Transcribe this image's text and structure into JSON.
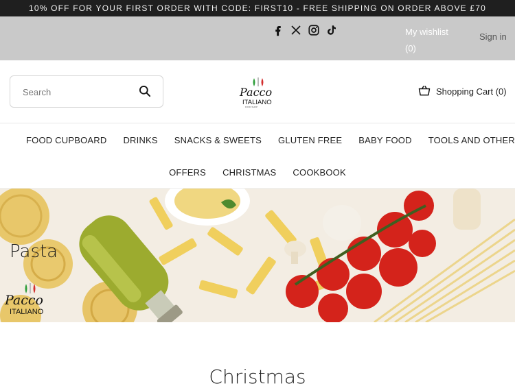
{
  "promo": {
    "text": "10% OFF FOR YOUR FIRST ORDER WITH CODE: FIRST10 - FREE SHIPPING ON ORDER ABOVE £70"
  },
  "topbar": {
    "social": [
      "facebook-icon",
      "x-icon",
      "instagram-icon",
      "tiktok-icon"
    ],
    "wishlist_label": "My wishlist",
    "wishlist_count": "(0)",
    "signin_label": "Sign in"
  },
  "header": {
    "search_placeholder": "Search",
    "logo": {
      "line1": "Pacco",
      "line2": "ITALIANO",
      "colors": [
        "#2e9e3a",
        "#ffffff",
        "#d32f2f"
      ]
    },
    "cart_label": "Shopping Cart (0)"
  },
  "nav": {
    "row1": [
      "FOOD CUPBOARD",
      "DRINKS",
      "SNACKS & SWEETS",
      "GLUTEN FREE",
      "BABY FOOD",
      "TOOLS AND OTHER"
    ],
    "row2": [
      "OFFERS",
      "CHRISTMAS",
      "COOKBOOK"
    ]
  },
  "banner": {
    "title": "Pasta"
  },
  "section": {
    "title": "Christmas"
  },
  "colors": {
    "promo_bg": "#1f1f1f",
    "topbar_bg": "#c9c9c9",
    "accent_green": "#2e9e3a",
    "accent_red": "#d32f2f"
  }
}
